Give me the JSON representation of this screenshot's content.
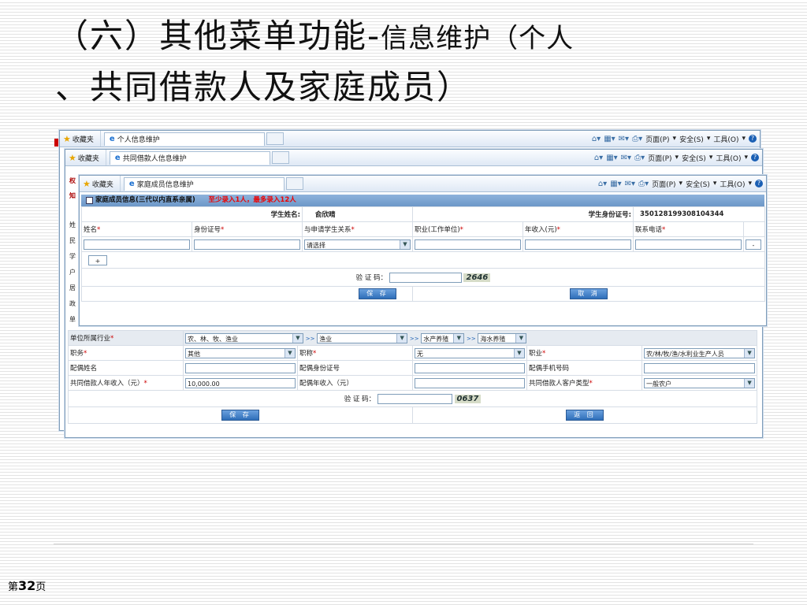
{
  "slide": {
    "title_big": "（六）其他菜单功能-",
    "title_small": "信息维护（个人",
    "title_line2": "、共同借款人及家庭成员）",
    "page_prefix": "第",
    "page_num": "32",
    "page_suffix": "页"
  },
  "browser": {
    "favorites": "收藏夹",
    "toolbar_items": [
      "页面(P)",
      "安全(S)",
      "工具(O)"
    ]
  },
  "win1": {
    "tab": "个人信息维护",
    "side_labels": [
      "权",
      "姓",
      "民",
      "学",
      "户",
      "居",
      "政",
      "单"
    ]
  },
  "win2": {
    "tab": "共同借款人信息维护",
    "side_labels": [
      "权",
      "知"
    ],
    "rows": [
      {
        "label": "单位所属行业",
        "req": true,
        "industry": [
          "农、林、牧、渔业",
          "渔业",
          "水产养殖",
          "海水养殖"
        ]
      },
      {
        "c1": "职务",
        "r1": true,
        "v1": "其他",
        "c2": "职称",
        "r2": true,
        "v2": "无",
        "c3": "职业",
        "r3": true,
        "v3": "农/林/牧/渔/水利业生产人员"
      },
      {
        "c1": "配偶姓名",
        "c2": "配偶身份证号",
        "c3": "配偶手机号码"
      },
      {
        "c1": "共同借款人年收入（元）",
        "r1": true,
        "v1": "10,000.00",
        "c2": "配偶年收入（元）",
        "c3": "共同借款人客户类型",
        "r3": true,
        "v3": "一般农户"
      }
    ],
    "captcha_label": "验 证 码：",
    "captcha": "0637",
    "save": "保 存",
    "back": "返 回"
  },
  "win3": {
    "tab": "家庭成员信息维护",
    "section_title": "家庭成员信息(三代以内直系亲属)",
    "section_note": "至少录入1人，最多录入12人",
    "student_name_label": "学生姓名:",
    "student_name": "俞欣晴",
    "student_id_label": "学生身份证号:",
    "student_id": "350128199308104344",
    "columns": [
      "姓名",
      "身份证号",
      "与申请学生关系",
      "职业(工作单位)",
      "年收入(元)",
      "联系电话"
    ],
    "relation_placeholder": "请选择",
    "add": "+",
    "remove": "-",
    "captcha_label": "验 证 码：",
    "captcha": "2646",
    "save": "保 存",
    "cancel": "取 消"
  }
}
